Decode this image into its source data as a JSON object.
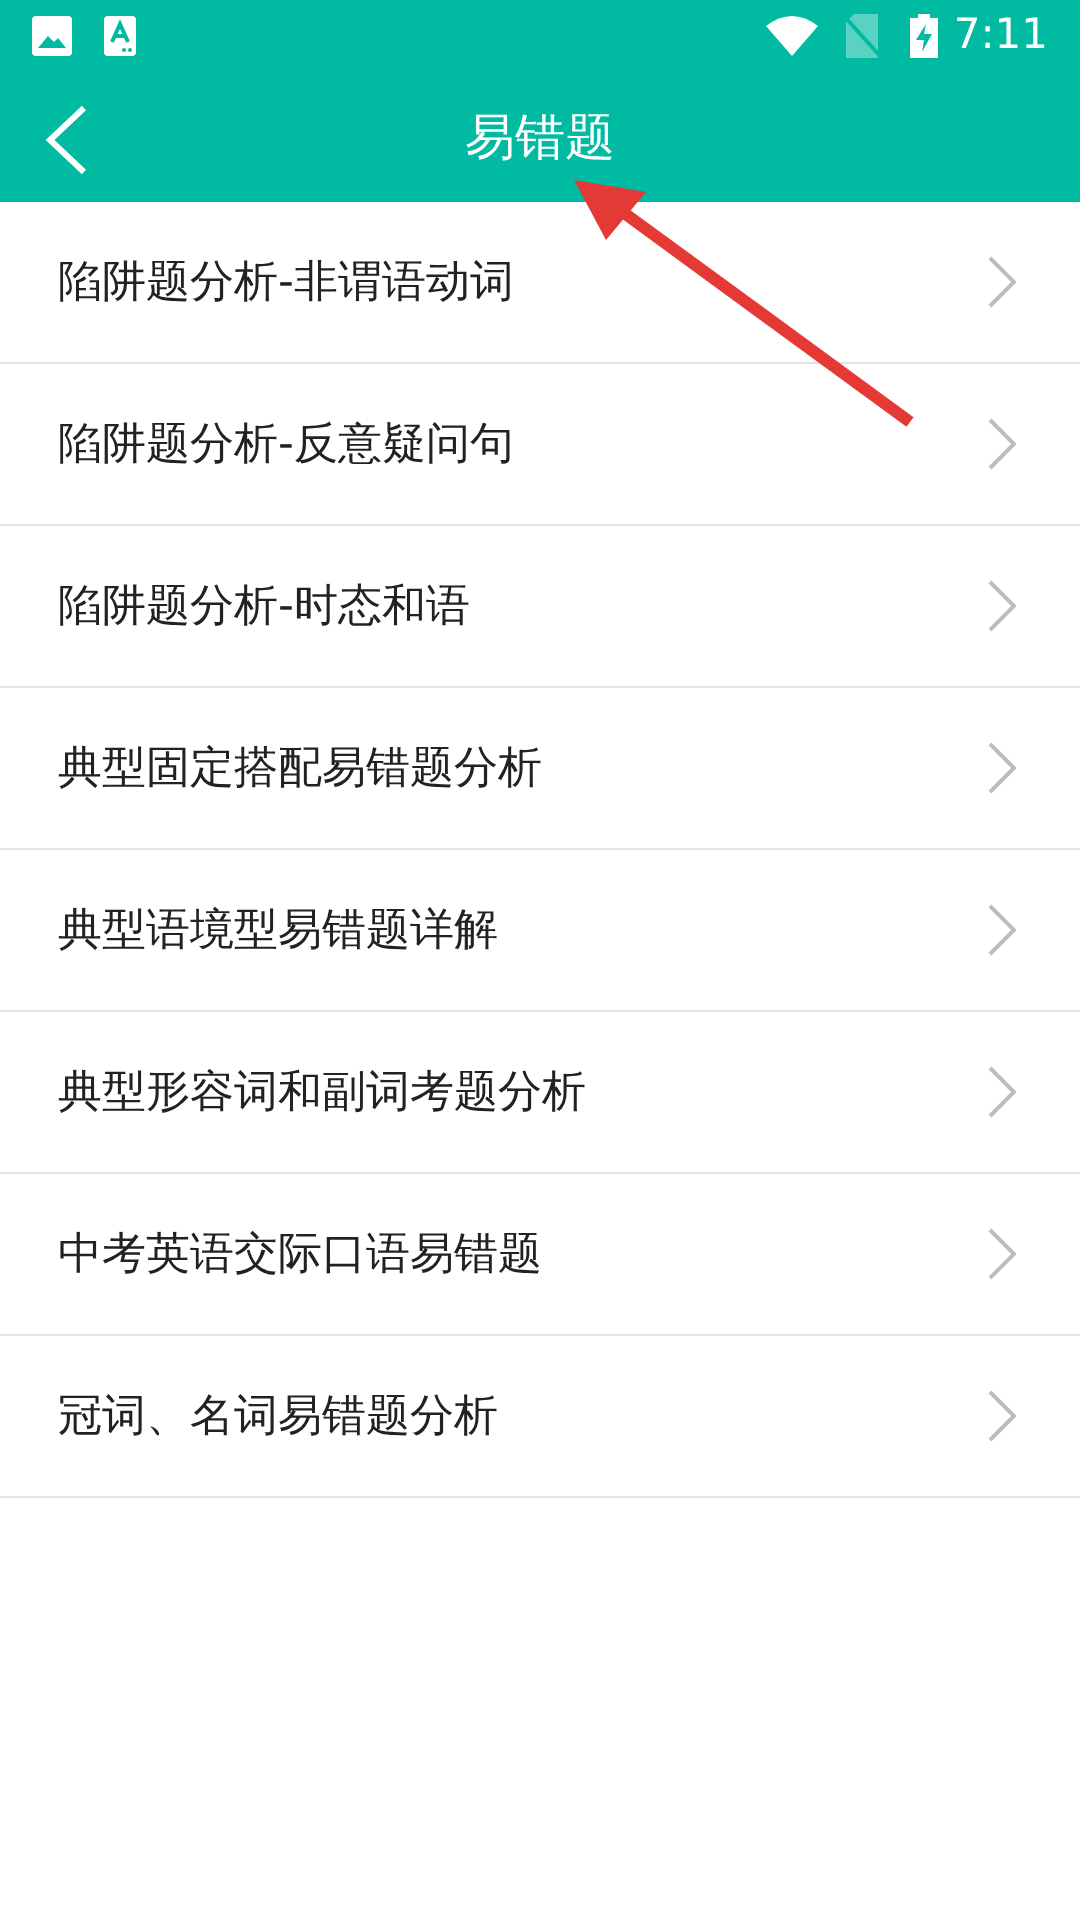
{
  "status_bar": {
    "time": "7:11"
  },
  "header": {
    "title": "易错题"
  },
  "items": [
    {
      "label": "陷阱题分析-非谓语动词"
    },
    {
      "label": "陷阱题分析-反意疑问句"
    },
    {
      "label": "陷阱题分析-时态和语"
    },
    {
      "label": "典型固定搭配易错题分析"
    },
    {
      "label": "典型语境型易错题详解"
    },
    {
      "label": "典型形容词和副词考题分析"
    },
    {
      "label": "中考英语交际口语易错题"
    },
    {
      "label": "冠词、名词易错题分析"
    }
  ]
}
